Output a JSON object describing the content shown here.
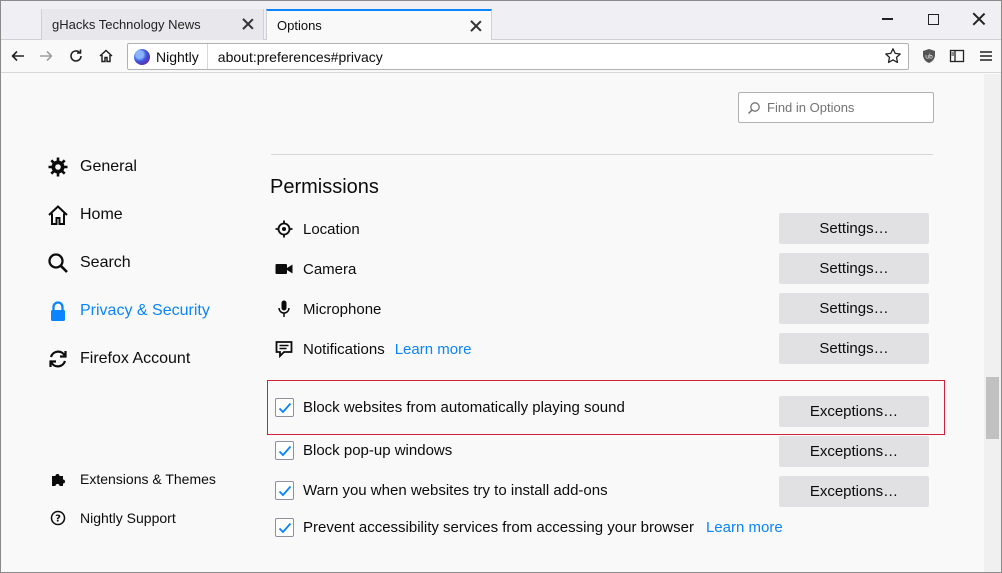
{
  "tabs": [
    {
      "label": "gHacks Technology News"
    },
    {
      "label": "Options"
    }
  ],
  "navbar": {
    "identity_label": "Nightly",
    "url": "about:preferences#privacy"
  },
  "find": {
    "placeholder": "Find in Options"
  },
  "sidebar": {
    "items": [
      {
        "label": "General",
        "icon": "gear-icon"
      },
      {
        "label": "Home",
        "icon": "home-icon"
      },
      {
        "label": "Search",
        "icon": "search-icon"
      },
      {
        "label": "Privacy & Security",
        "icon": "lock-icon",
        "selected": true
      },
      {
        "label": "Firefox Account",
        "icon": "sync-icon"
      }
    ],
    "footer": [
      {
        "label": "Extensions & Themes",
        "icon": "puzzle-icon"
      },
      {
        "label": "Nightly Support",
        "icon": "help-icon"
      }
    ]
  },
  "permissions": {
    "title": "Permissions",
    "rows": [
      {
        "label": "Location",
        "button": "Settings…"
      },
      {
        "label": "Camera",
        "button": "Settings…"
      },
      {
        "label": "Microphone",
        "button": "Settings…"
      },
      {
        "label": "Notifications",
        "link": "Learn more",
        "button": "Settings…"
      }
    ],
    "checks": [
      {
        "label": "Block websites from automatically playing sound",
        "checked": true,
        "button": "Exceptions…"
      },
      {
        "label": "Block pop-up windows",
        "checked": true,
        "button": "Exceptions…"
      },
      {
        "label": "Warn you when websites try to install add-ons",
        "checked": true,
        "button": "Exceptions…"
      },
      {
        "label": "Prevent accessibility services from accessing your browser",
        "checked": true,
        "link": "Learn more"
      }
    ]
  },
  "colors": {
    "accent": "#0a84ff",
    "highlight_border": "#d0213a"
  }
}
